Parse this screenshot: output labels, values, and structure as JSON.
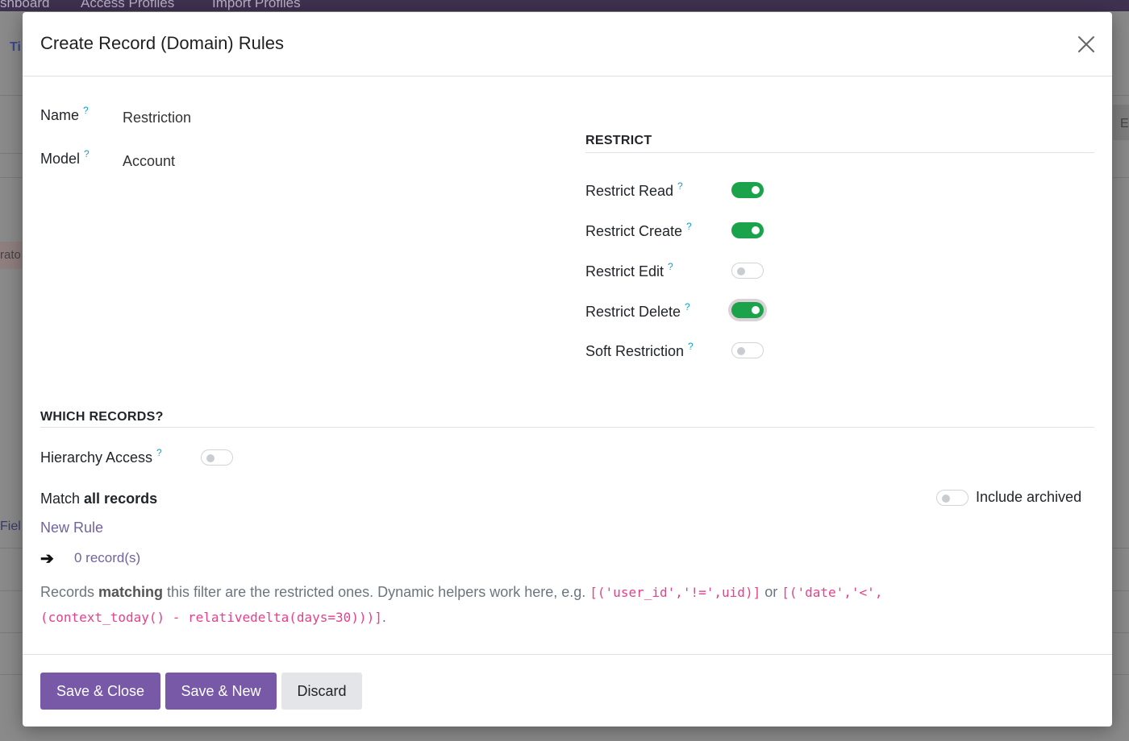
{
  "background": {
    "nav_items": [
      "shboard",
      "Access Profiles",
      "Import Profiles"
    ],
    "fragments": [
      "Ti",
      "E",
      "rato",
      "Fiel"
    ]
  },
  "modal": {
    "title": "Create Record (Domain) Rules",
    "fields": {
      "name": {
        "label": "Name",
        "help": "?",
        "value": "Restriction"
      },
      "model": {
        "label": "Model",
        "help": "?",
        "value": "Account"
      }
    },
    "restrict": {
      "title": "RESTRICT",
      "toggles": [
        {
          "label": "Restrict Read",
          "help": "?",
          "on": true
        },
        {
          "label": "Restrict Create",
          "help": "?",
          "on": true
        },
        {
          "label": "Restrict Edit",
          "help": "?",
          "on": false
        },
        {
          "label": "Restrict Delete",
          "help": "?",
          "on": true
        },
        {
          "label": "Soft Restriction",
          "help": "?",
          "on": false
        }
      ]
    },
    "which_records": {
      "title": "WHICH RECORDS?",
      "hierarchy_access": {
        "label": "Hierarchy Access",
        "help": "?",
        "on": false
      },
      "match_prefix": "Match",
      "match_bold": "all records",
      "include_archived": {
        "label": "Include archived",
        "on": false
      },
      "new_rule": "New Rule",
      "arrow": "➔",
      "record_count": "0 record(s)",
      "help_text": {
        "part1": "Records ",
        "bold": "matching",
        "part2": " this filter are the restricted ones. Dynamic helpers work here, e.g. ",
        "code1": "[('user_id','!=',uid)]",
        "or": " or ",
        "code2": "[('date','<',",
        "code3": "(context_today() - relativedelta(days=30)))]",
        "end": "."
      }
    },
    "footer": {
      "save_close": "Save & Close",
      "save_new": "Save & New",
      "discard": "Discard"
    }
  },
  "colors": {
    "toggle_on": "#1aa34a",
    "primary": "#7859a8",
    "help": "#0aa5c4",
    "link": "#71639e",
    "code": "#e83e8c"
  }
}
